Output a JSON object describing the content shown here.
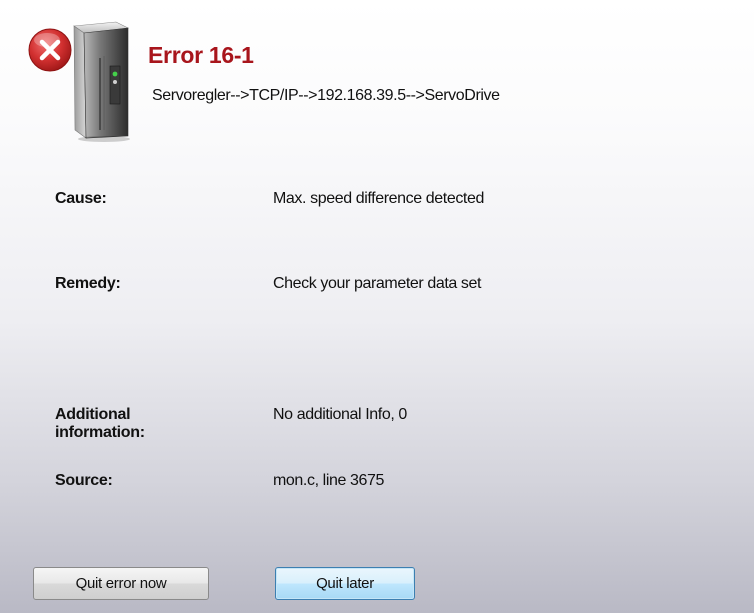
{
  "error": {
    "title": "Error 16-1",
    "path": "Servoregler-->TCP/IP-->192.168.39.5-->ServoDrive"
  },
  "details": {
    "cause_label": "Cause:",
    "cause_value": "Max. speed difference detected",
    "remedy_label": "Remedy:",
    "remedy_value": "Check your parameter data set",
    "additional_label_line1": "Additional",
    "additional_label_line2": "information:",
    "additional_value": "No additional Info, 0",
    "source_label": "Source:",
    "source_value": "mon.c, line 3675"
  },
  "buttons": {
    "quit_now": "Quit error now",
    "quit_later": "Quit later"
  },
  "icons": {
    "device": "server-drive-icon",
    "error": "error-x-icon"
  },
  "colors": {
    "title": "#a8151c",
    "error_badge": "#c62828",
    "default_button_border": "#3c7fb1"
  }
}
